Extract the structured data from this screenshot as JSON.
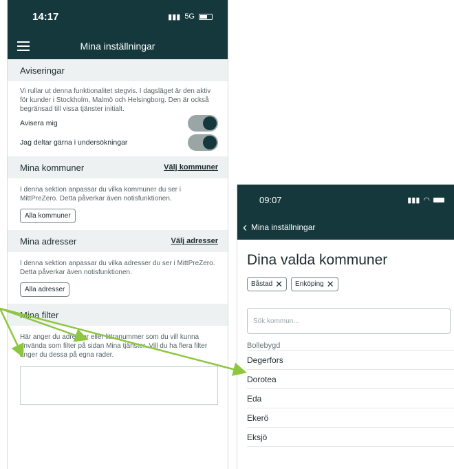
{
  "left_phone": {
    "status_bar": {
      "time": "14:17",
      "network": "5G"
    },
    "nav": {
      "title": "Mina inställningar",
      "menu_icon": "hamburger-icon"
    },
    "aviseringar": {
      "heading": "Aviseringar",
      "description": "Vi rullar ut denna funktionalitet stegvis. I dagsläget är den aktiv för kunder i Stockholm, Malmö och Helsingborg. Den är också begränsad till vissa tjänster initialt.",
      "toggles": [
        {
          "label": "Avisera mig",
          "on": true
        },
        {
          "label": "Jag deltar gärna i undersökningar",
          "on": true
        }
      ]
    },
    "kommuner": {
      "heading": "Mina kommuner",
      "link": "Välj kommuner",
      "description": "I denna sektion anpassar du vilka kommuner du ser i MittPreZero. Detta påverkar även notisfunktionen.",
      "button": "Alla kommuner"
    },
    "adresser": {
      "heading": "Mina adresser",
      "link": "Välj adresser",
      "description": "I denna sektion anpassar du vilka adresser du ser i MittPreZero. Detta påverkar även notisfunktionen.",
      "button": "Alla adresser"
    },
    "filter": {
      "heading": "Mina filter",
      "description": "Här anger du adresser eller littranummer som du vill kunna använda som filter på sidan Mina tjänster. Vill du ha flera filter anger du dessa på egna rader."
    }
  },
  "right_phone": {
    "status_bar": {
      "time": "09:07"
    },
    "nav": {
      "back_label": "Mina inställningar"
    },
    "title": "Dina valda kommuner",
    "chips": [
      "Båstad",
      "Enköping"
    ],
    "search": {
      "placeholder": "Sök kommun..."
    },
    "list_partial": "Bollebygd",
    "list": [
      "Degerfors",
      "Dorotea",
      "Eda",
      "Ekerö",
      "Eksjö"
    ]
  },
  "colors": {
    "header": "#15383d",
    "section_bg": "#eef1f1",
    "arrow": "#8dc63f"
  }
}
